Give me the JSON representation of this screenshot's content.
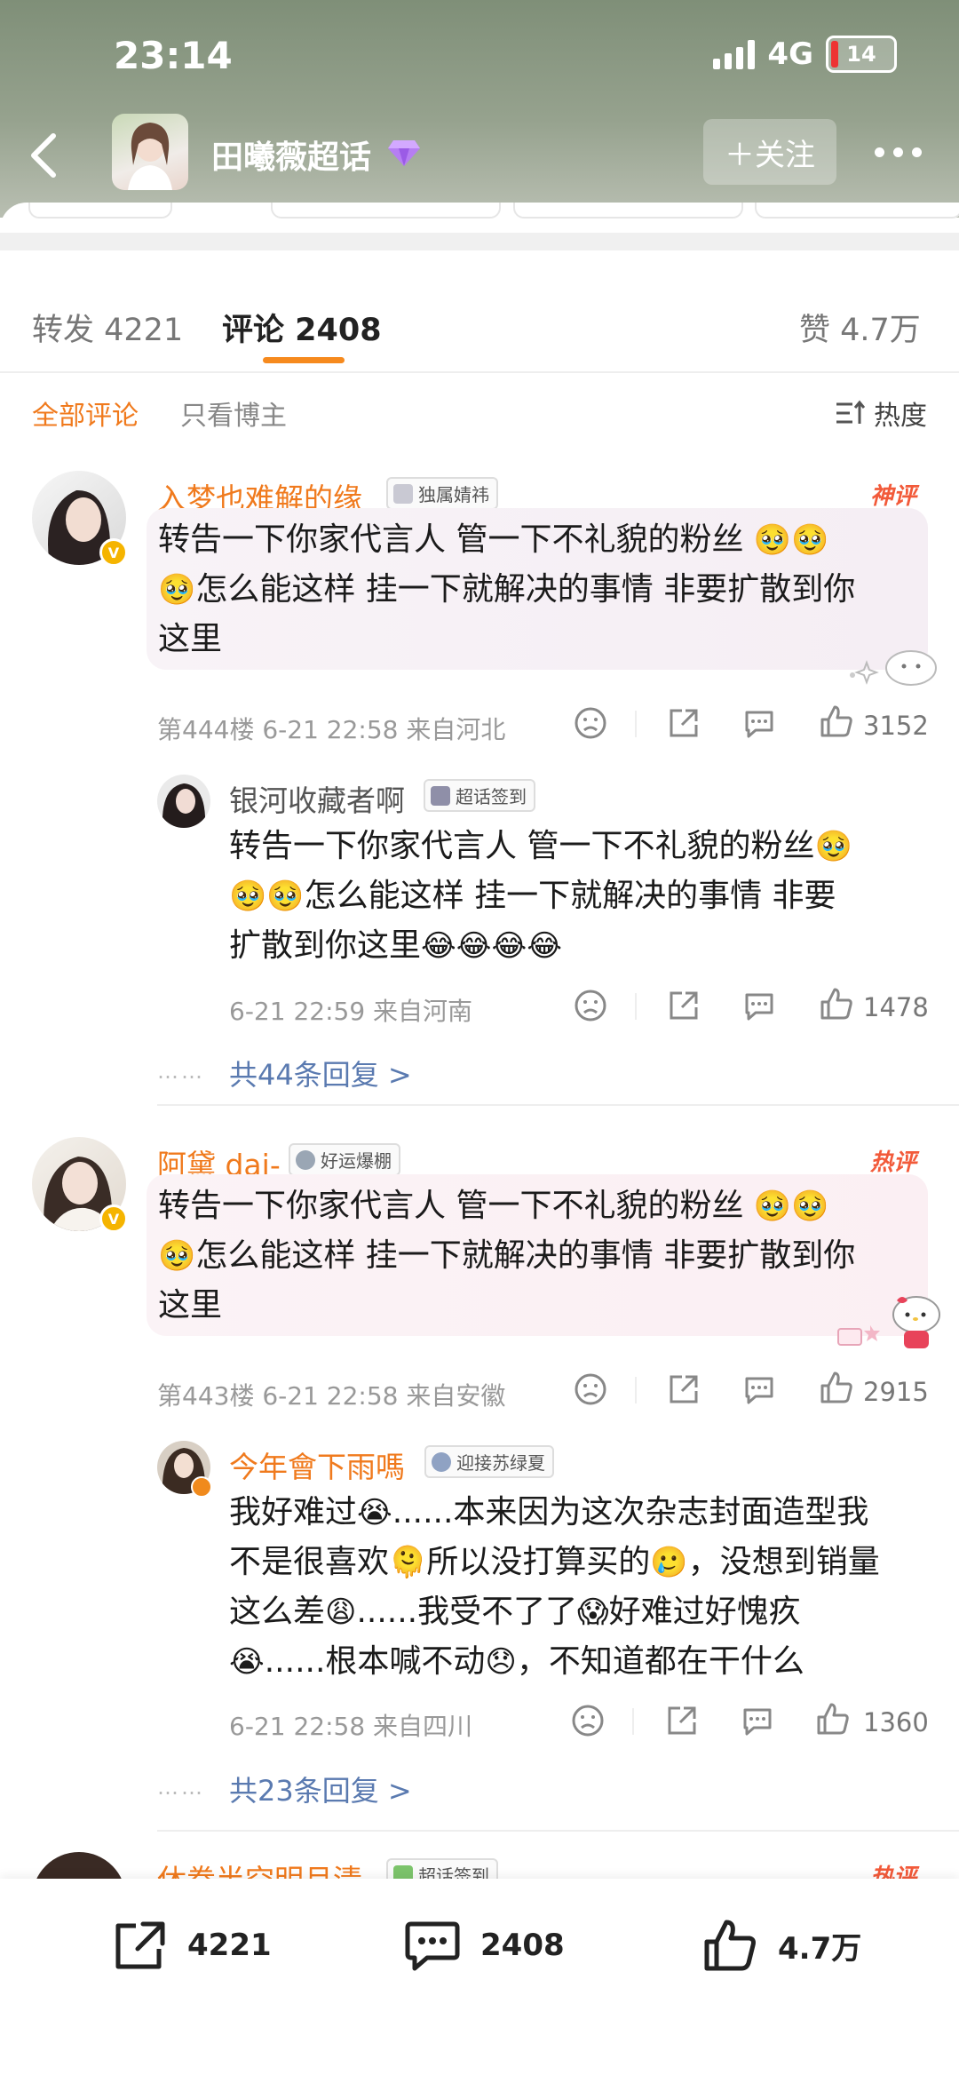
{
  "status": {
    "time": "23:14",
    "network": "4G",
    "battery": "14"
  },
  "header": {
    "title": "田曦薇超话",
    "follow_label": "＋关注"
  },
  "tabs": {
    "repost_label": "转发 4221",
    "comment_label": "评论 2408",
    "like_label": "赞 4.7万"
  },
  "filters": {
    "all_label": "全部评论",
    "author_only_label": "只看博主",
    "sort_label": "热度"
  },
  "comments": [
    {
      "username": "入梦也难解的缘",
      "tag": "独属婧祎",
      "badge": "神评",
      "text_line1": "转告一下你家代言人  管一下不礼貌的粉丝",
      "text_line2": "怎么能这样  挂一下就解决的事情  非要扩散到你",
      "text_line3": "这里",
      "meta": "第444楼 6-21 22:58 来自河北",
      "likes": "3152",
      "reply": {
        "username": "银河收藏者啊",
        "tag": "超话签到",
        "text_line1": "转告一下你家代言人  管一下不礼貌的粉丝",
        "text_line2": "怎么能这样  挂一下就解决的事情  非要",
        "text_line3": "扩散到你这里",
        "meta": "6-21 22:59 来自河南",
        "likes": "1478"
      },
      "more_replies": "共44条回复 >"
    },
    {
      "username": "阿黛 dai-",
      "tag": "好运爆棚",
      "badge": "热评",
      "text_line1": "转告一下你家代言人  管一下不礼貌的粉丝",
      "text_line2": "怎么能这样  挂一下就解决的事情  非要扩散到你",
      "text_line3": "这里",
      "meta": "第443楼 6-21 22:58 来自安徽",
      "likes": "2915",
      "reply": {
        "username": "今年會下雨嗎",
        "tag": "迎接苏绿夏",
        "text_line1a": "我好难过",
        "text_line1b": "......本来因为这次杂志封面造型我",
        "text_line2a": "不是很喜欢",
        "text_line2b": "所以没打算买的",
        "text_line2c": "，没想到销量",
        "text_line3a": "这么差",
        "text_line3b": "......我受不了了",
        "text_line3c": "好难过好愧疚",
        "text_line4a": "......根本喊不动",
        "text_line4b": "，不知道都在干什么",
        "meta": "6-21 22:58 来自四川",
        "likes": "1360"
      },
      "more_replies": "共23条回复 >"
    },
    {
      "username": "休眷半空明月清",
      "tag": "超话签到",
      "badge": "热评"
    }
  ],
  "bottom_bar": {
    "repost_count": "4221",
    "comment_count": "2408",
    "like_count": "4.7万"
  },
  "colors": {
    "accent": "#f68a1e",
    "username": "#f07a1d",
    "link": "#5a7ab0"
  }
}
